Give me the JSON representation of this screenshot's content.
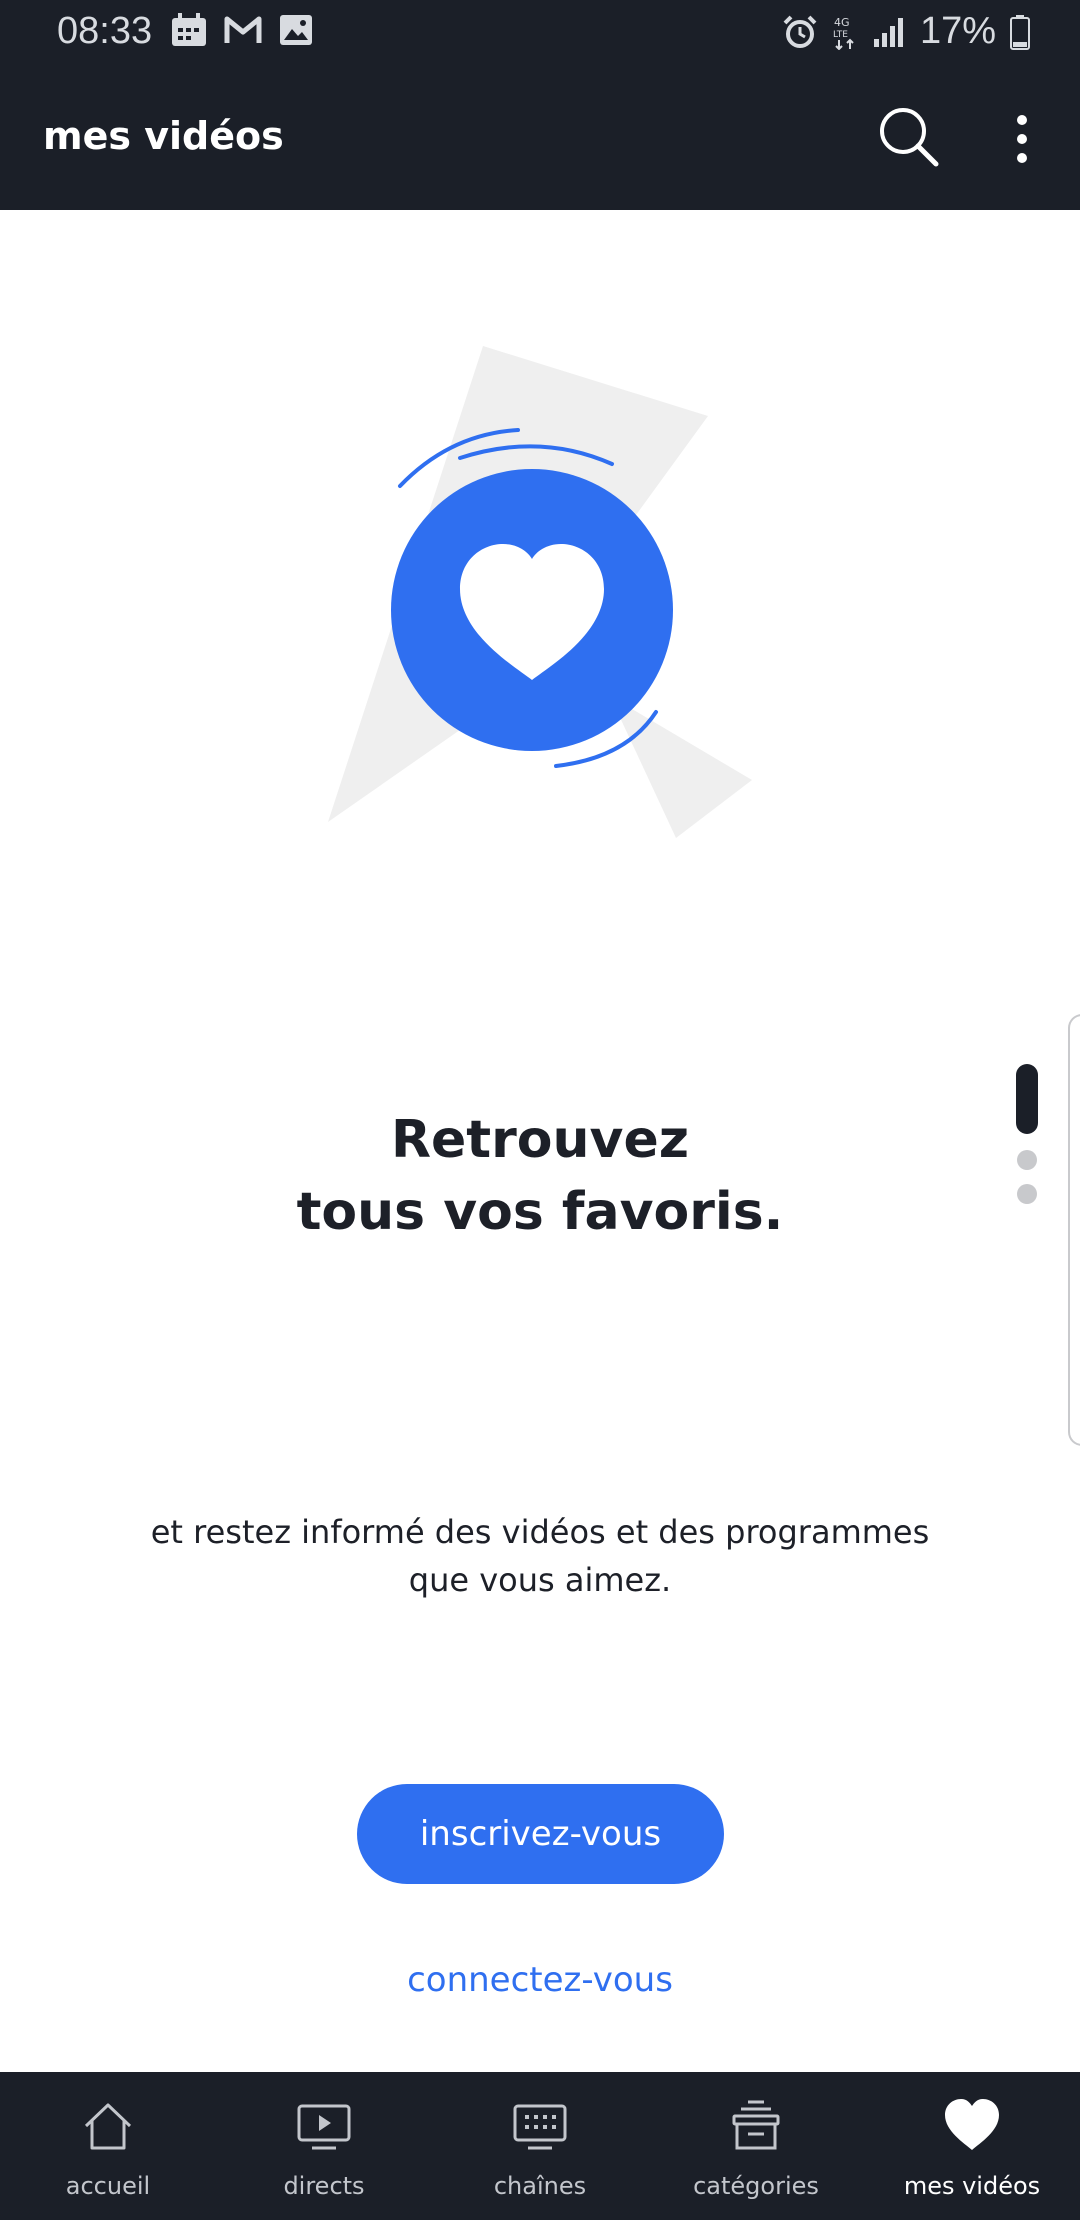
{
  "status_bar": {
    "time": "08:33",
    "battery": "17%",
    "left_icons": [
      "calendar-icon",
      "gmail-icon",
      "gallery-icon"
    ],
    "right_icons": [
      "alarm-icon",
      "4g-lte-icon",
      "signal-icon",
      "battery-icon"
    ]
  },
  "app_bar": {
    "title": "mes vidéos",
    "actions": [
      "search-icon",
      "more-vert-icon"
    ]
  },
  "empty_state": {
    "illustration_icon": "heart-icon",
    "headline_line1": "Retrouvez",
    "headline_line2": "tous vos favoris.",
    "subtitle_line1": "et restez informé des vidéos et des programmes",
    "subtitle_line2": "que vous aimez.",
    "signup_label": "inscrivez-vous",
    "login_label": "connectez-vous",
    "pager": {
      "pages": 3,
      "active_index": 0
    }
  },
  "bottom_nav": {
    "items": [
      {
        "label": "accueil",
        "icon": "home-icon"
      },
      {
        "label": "directs",
        "icon": "live-tv-icon"
      },
      {
        "label": "chaînes",
        "icon": "channels-grid-icon"
      },
      {
        "label": "catégories",
        "icon": "categories-stack-icon"
      },
      {
        "label": "mes vidéos",
        "icon": "heart-icon",
        "active": true
      }
    ]
  },
  "colors": {
    "dark_bar": "#1b1f28",
    "accent_blue": "#2f6ff0",
    "text_dark": "#1d2028",
    "shape_grey": "#efefef"
  }
}
